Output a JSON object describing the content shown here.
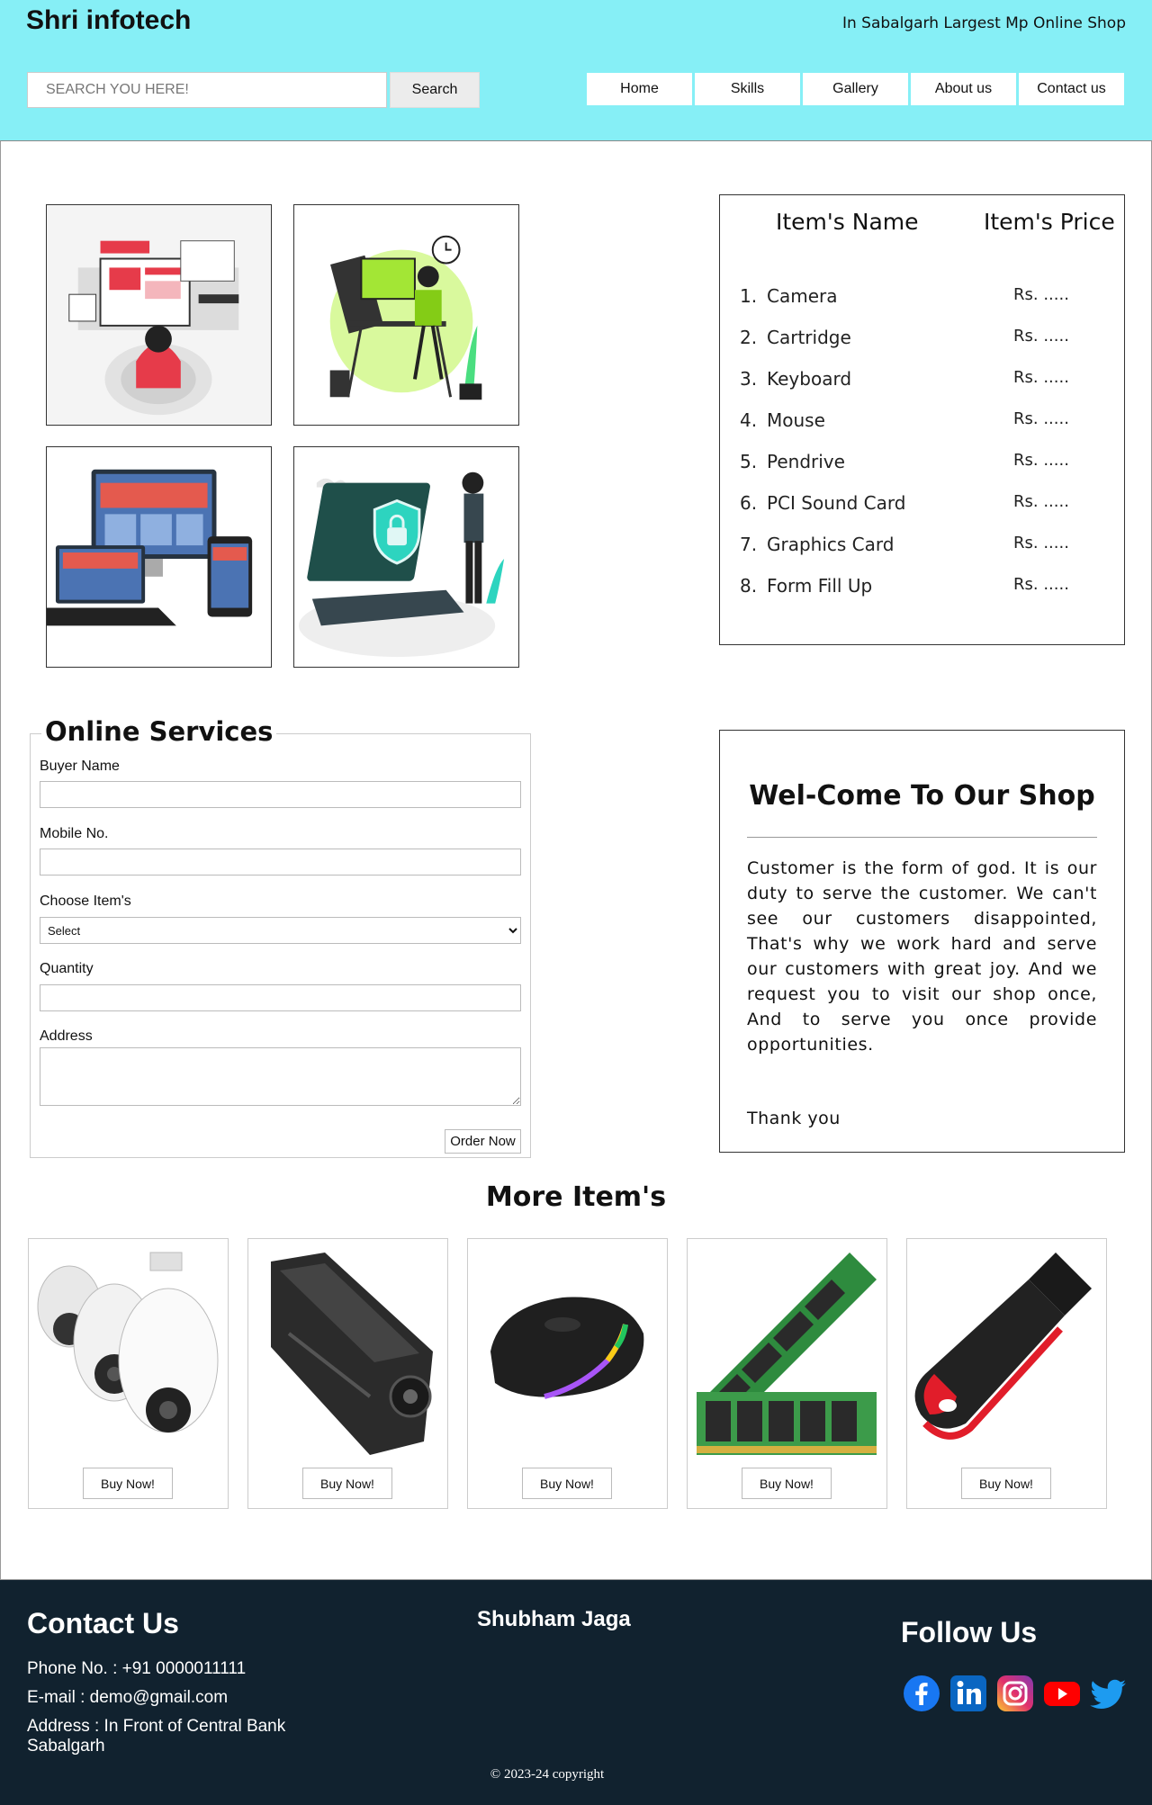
{
  "header": {
    "brand": "Shri infotech",
    "tagline": "In Sabalgarh Largest Mp Online Shop",
    "search_placeholder": "SEARCH YOU HERE!",
    "search_button": "Search",
    "background_color": "#86eff6",
    "nav": [
      "Home",
      "Skills",
      "Gallery",
      "About us",
      "Contact us"
    ]
  },
  "gallery": {
    "tiles": [
      "ui-design-illustration",
      "designer-at-desk-illustration",
      "responsive-design-illustration",
      "security-laptop-illustration"
    ]
  },
  "price_table": {
    "name_header": "Item's Name",
    "price_header": "Item's Price",
    "items": [
      {
        "num": "1.",
        "name": "Camera",
        "price": "Rs. ....."
      },
      {
        "num": "2.",
        "name": "Cartridge",
        "price": "Rs. ....."
      },
      {
        "num": "3.",
        "name": "Keyboard",
        "price": "Rs. ....."
      },
      {
        "num": "4.",
        "name": "Mouse",
        "price": "Rs. ....."
      },
      {
        "num": "5.",
        "name": "Pendrive",
        "price": "Rs. ....."
      },
      {
        "num": "6.",
        "name": "PCI Sound Card",
        "price": "Rs. ....."
      },
      {
        "num": "7.",
        "name": "Graphics Card",
        "price": "Rs. ....."
      },
      {
        "num": "8.",
        "name": "Form Fill Up",
        "price": "Rs. ....."
      }
    ]
  },
  "order_form": {
    "legend": "Online Services",
    "buyer_name_label": "Buyer Name",
    "mobile_label": "Mobile No.",
    "item_label": "Choose Item's",
    "item_selected": "Select",
    "quantity_label": "Quantity",
    "address_label": "Address",
    "submit": "Order Now"
  },
  "welcome": {
    "title": "Wel-Come To Our Shop",
    "text": "Customer is the form of god. It is our duty to serve the customer. We can't see our customers disappointed, That's why we work hard and serve our customers with great joy. And we request you to visit our shop once, And to serve you once provide opportunities.",
    "thanks": "Thank you"
  },
  "more_items": {
    "title": "More Item's",
    "cards": [
      {
        "image": "cctv-camera",
        "button": "Buy Now!"
      },
      {
        "image": "toner-cartridge",
        "button": "Buy Now!"
      },
      {
        "image": "gaming-mouse",
        "button": "Buy Now!"
      },
      {
        "image": "ram-module",
        "button": "Buy Now!"
      },
      {
        "image": "pendrive",
        "button": "Buy Now!"
      }
    ]
  },
  "footer": {
    "contact_title": "Contact Us",
    "phone": "Phone No. : +91 0000011111",
    "email": "E-mail : demo@gmail.com",
    "address": "Address : In Front of Central Bank",
    "address_city": "Sabalgarh",
    "name": "Shubham Jaga",
    "follow_title": "Follow Us",
    "social": [
      "facebook-icon",
      "linkedin-icon",
      "instagram-icon",
      "youtube-icon",
      "twitter-icon"
    ],
    "copyright": "© 2023-24 copyright",
    "background_color": "#11222f"
  }
}
